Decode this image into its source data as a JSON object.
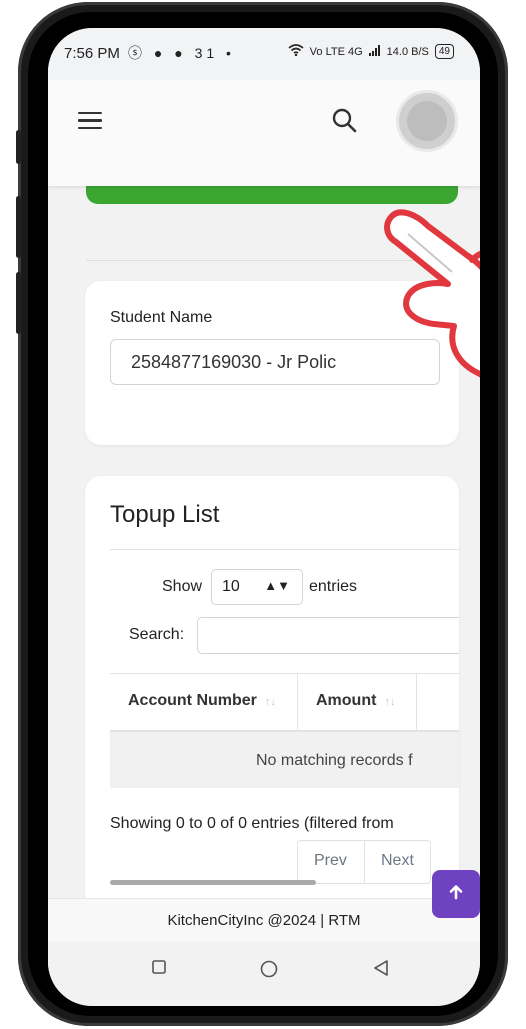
{
  "status_bar": {
    "time": "7:56 PM",
    "left_icons": "ⓢ ● ● 31 •",
    "network": "Vo LTE 4G",
    "speed": "14.0 B/S",
    "battery": "49"
  },
  "header": {
    "menu_icon": "hamburger-icon",
    "search_icon": "search-icon",
    "avatar_icon": "avatar"
  },
  "student": {
    "label": "Student Name",
    "selected": "2584877169030 - Jr Polic"
  },
  "topup": {
    "title": "Topup List",
    "show_label": "Show",
    "entries_value": "10",
    "entries_label": "entries",
    "search_label": "Search:",
    "columns": [
      "Account Number",
      "Amount"
    ],
    "empty_message": "No matching records f",
    "info": "Showing 0 to 0 of 0 entries (filtered from",
    "prev_label": "Prev",
    "next_label": "Next"
  },
  "fab_icon": "arrow-up-icon",
  "footer": {
    "text": "KitchenCityInc @2024 | RTM"
  },
  "colors": {
    "accent_green": "#3aa630",
    "fab_purple": "#6f42c1",
    "hand_outline": "#e0383e"
  }
}
